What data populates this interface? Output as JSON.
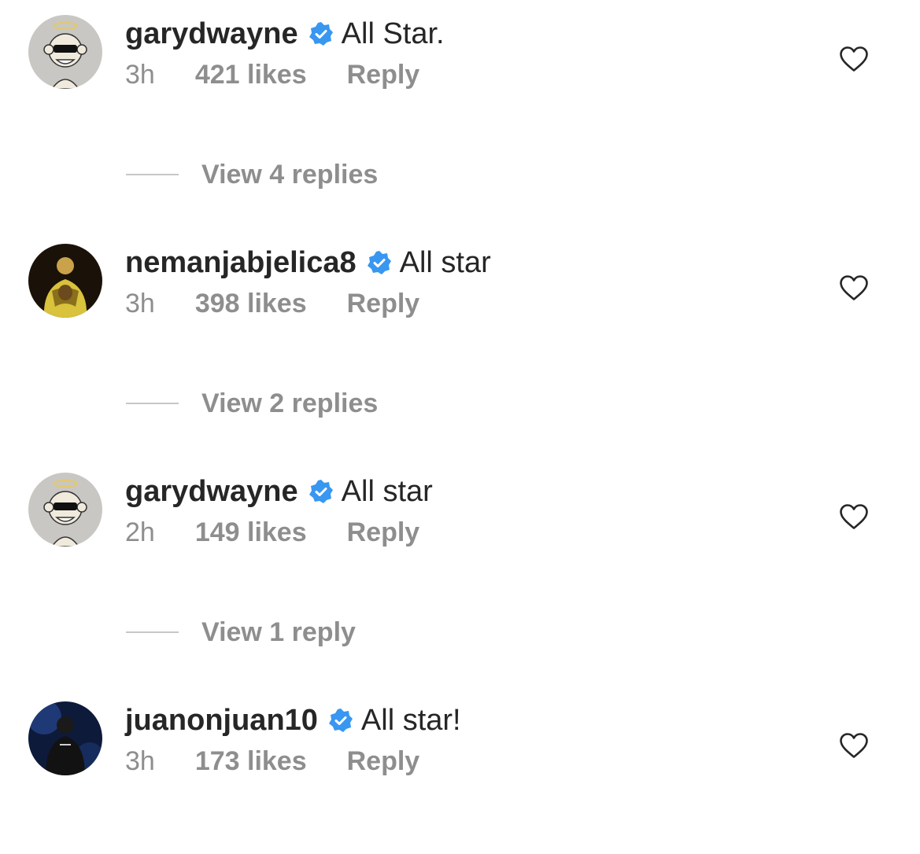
{
  "comments": [
    {
      "avatar": "monkey-halo-avatar",
      "username": "garydwayne",
      "verified": true,
      "text": "All Star.",
      "time": "3h",
      "likes": "421 likes",
      "reply_label": "Reply",
      "view_replies": "View 4 replies"
    },
    {
      "avatar": "player-photo-avatar",
      "username": "nemanjabjelica8",
      "verified": true,
      "text": "All star",
      "time": "3h",
      "likes": "398 likes",
      "reply_label": "Reply",
      "view_replies": "View 2 replies"
    },
    {
      "avatar": "monkey-halo-avatar",
      "username": "garydwayne",
      "verified": true,
      "text": "All star",
      "time": "2h",
      "likes": "149 likes",
      "reply_label": "Reply",
      "view_replies": "View 1 reply"
    },
    {
      "avatar": "player-photo-avatar-dark",
      "username": "juanonjuan10",
      "verified": true,
      "text": "All star!",
      "time": "3h",
      "likes": "173 likes",
      "reply_label": "Reply"
    }
  ],
  "colors": {
    "text_primary": "#262626",
    "text_secondary": "#8e8e8e",
    "verified_blue": "#3897f0",
    "divider": "#c7c7c7"
  }
}
